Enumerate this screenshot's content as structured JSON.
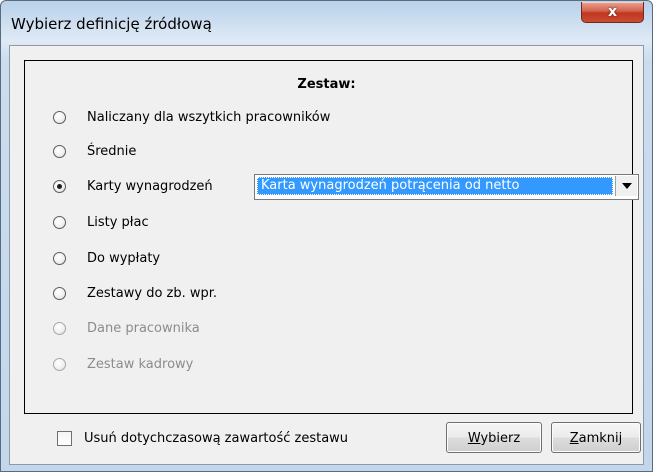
{
  "window": {
    "title": "Wybierz definicję źródłową",
    "close_glyph": "x"
  },
  "group_title": "Zestaw:",
  "options": [
    {
      "label": "Naliczany dla wszytkich pracowników",
      "checked": false,
      "enabled": true
    },
    {
      "label": "Średnie",
      "checked": false,
      "enabled": true
    },
    {
      "label": "Karty wynagrodzeń",
      "checked": true,
      "enabled": true
    },
    {
      "label": "Listy płac",
      "checked": false,
      "enabled": true
    },
    {
      "label": "Do wypłaty",
      "checked": false,
      "enabled": true
    },
    {
      "label": "Zestawy do zb. wpr.",
      "checked": false,
      "enabled": true
    },
    {
      "label": "Dane pracownika",
      "checked": false,
      "enabled": false
    },
    {
      "label": "Zestaw kadrowy",
      "checked": false,
      "enabled": false
    }
  ],
  "card_combo": {
    "selected": "Karta wynagrodzeń potrącenia od netto"
  },
  "clear_checkbox": {
    "label": "Usuń dotychczasową zawartość zestawu",
    "checked": false
  },
  "buttons": {
    "select_underlined": "W",
    "select_rest": "ybierz",
    "close_underlined": "Z",
    "close_rest": "amknij"
  },
  "colors": {
    "selection": "#3399ff",
    "close_button": "#c94d33",
    "disabled_text": "#8c8c8c"
  }
}
